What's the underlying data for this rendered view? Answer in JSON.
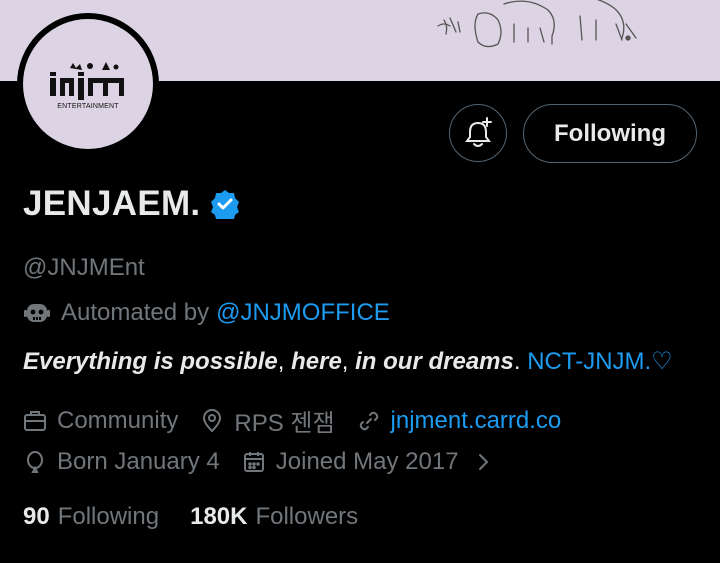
{
  "banner": {
    "illustration": "sketched-animals"
  },
  "avatar": {
    "logo_text": "ENTERTAINMENT"
  },
  "actions": {
    "bell_icon": "bell-plus-icon",
    "follow_label": "Following"
  },
  "profile": {
    "display_name": "JENJAEM.",
    "verified_icon": "verified-badge-icon",
    "handle": "@JNJMEnt",
    "automated_label": "Automated by",
    "automated_by": "@JNJMOFFICE",
    "bio": {
      "p1": "Everything is possible",
      "sep1": ", ",
      "p2": "here",
      "sep2": ", ",
      "p3": "in our dreams",
      "sep3": ". ",
      "link": "NCT-JNJM.♡"
    },
    "category": "Community",
    "location": "RPS 젠잼",
    "website": "jnjment.carrd.co",
    "birthday": "Born January 4",
    "joined": "Joined May 2017"
  },
  "stats": {
    "following_count": "90",
    "following_label": "Following",
    "followers_count": "180K",
    "followers_label": "Followers"
  },
  "colors": {
    "accent": "#1d9bf0",
    "banner": "#dcd3e4",
    "muted": "#71767b"
  }
}
